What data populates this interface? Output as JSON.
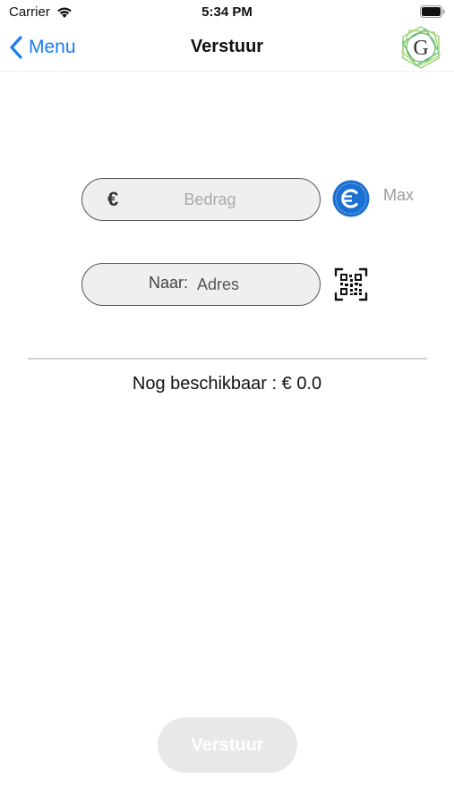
{
  "status_bar": {
    "carrier": "Carrier",
    "time": "5:34 PM"
  },
  "nav": {
    "back_label": "Menu",
    "title": "Verstuur",
    "logo_letter": "G"
  },
  "form": {
    "amount": {
      "currency_symbol": "€",
      "placeholder": "Bedrag",
      "value": ""
    },
    "max_label": "Max",
    "address": {
      "prefix": "Naar:",
      "placeholder": "Adres",
      "value": ""
    }
  },
  "available_text": "Nog beschikbaar : € 0.0",
  "send_button_label": "Verstuur",
  "colors": {
    "accent_blue": "#1a7cf3",
    "coin_blue": "#1a6fd1",
    "logo_green": "#6fbf5a",
    "disabled_button": "#e8e8e8"
  }
}
